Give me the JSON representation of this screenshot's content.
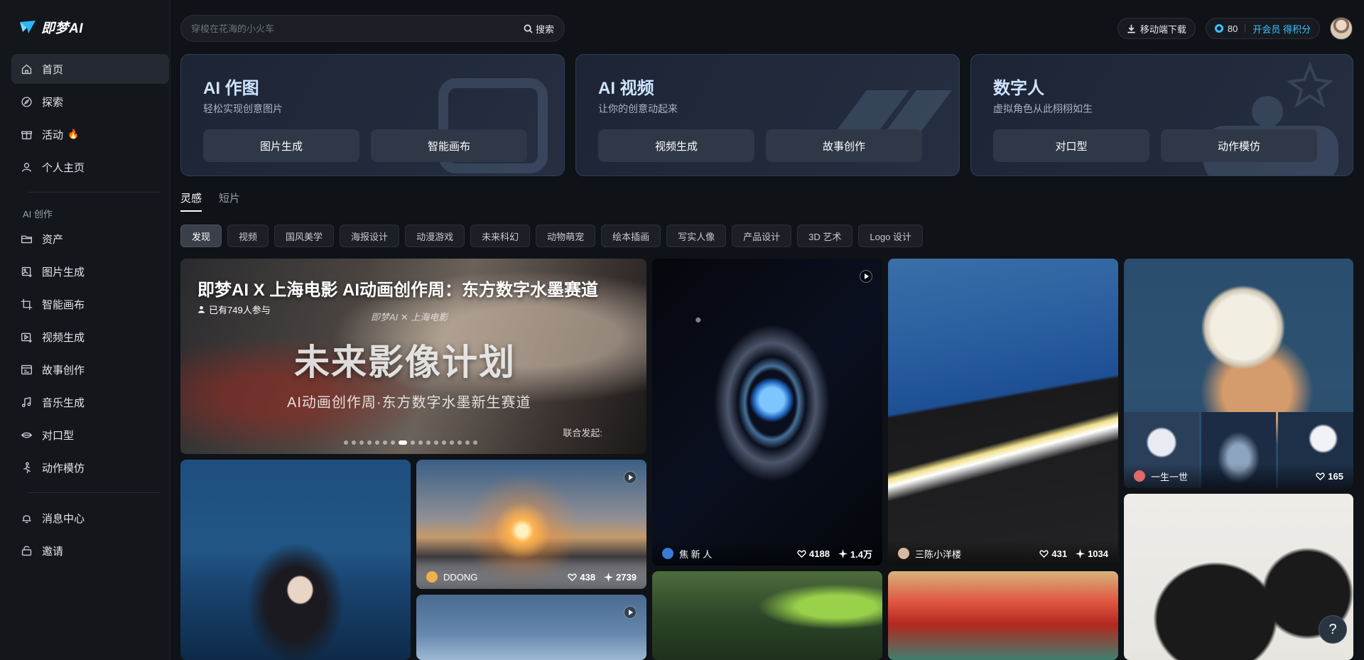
{
  "app": {
    "logo_text": "即梦AI"
  },
  "sidebar": {
    "items": [
      {
        "label": "首页",
        "icon": "home-icon",
        "active": true
      },
      {
        "label": "探索",
        "icon": "compass-icon"
      },
      {
        "label": "活动",
        "icon": "gift-icon",
        "badge": "fire-icon"
      },
      {
        "label": "个人主页",
        "icon": "user-icon"
      }
    ],
    "section_title": "AI 创作",
    "create_items": [
      {
        "label": "资产",
        "icon": "folder-icon"
      },
      {
        "label": "图片生成",
        "icon": "image-plus-icon"
      },
      {
        "label": "智能画布",
        "icon": "crop-icon"
      },
      {
        "label": "视频生成",
        "icon": "video-plus-icon"
      },
      {
        "label": "故事创作",
        "icon": "story-icon"
      },
      {
        "label": "音乐生成",
        "icon": "music-icon"
      },
      {
        "label": "对口型",
        "icon": "lips-icon"
      },
      {
        "label": "动作模仿",
        "icon": "motion-icon"
      }
    ],
    "bottom_items": [
      {
        "label": "消息中心",
        "icon": "bell-icon"
      },
      {
        "label": "邀请",
        "icon": "lock-icon"
      }
    ]
  },
  "search": {
    "placeholder": "穿梭在花海的小火车",
    "button_label": "搜索"
  },
  "header": {
    "download_label": "移动端下载",
    "credits": "80",
    "vip_label": "开会员 得积分"
  },
  "features": [
    {
      "title": "AI 作图",
      "subtitle": "轻松实现创意图片",
      "buttons": [
        "图片生成",
        "智能画布"
      ]
    },
    {
      "title": "AI 视频",
      "subtitle": "让你的创意动起来",
      "buttons": [
        "视频生成",
        "故事创作"
      ]
    },
    {
      "title": "数字人",
      "subtitle": "虚拟角色从此栩栩如生",
      "buttons": [
        "对口型",
        "动作模仿"
      ]
    }
  ],
  "tabs": [
    "灵感",
    "短片"
  ],
  "chips": [
    "发现",
    "视频",
    "国风美学",
    "海报设计",
    "动漫游戏",
    "未来科幻",
    "动物萌宠",
    "绘本插画",
    "写实人像",
    "产品设计",
    "3D 艺术",
    "Logo 设计"
  ],
  "banner": {
    "title": "即梦AI X 上海电影 AI动画创作周：东方数字水墨赛道",
    "participants": "已有749人参与",
    "logos": "即梦AI  ✕  上海电影",
    "big_text": "未来影像计划",
    "sub_text": "AI动画创作周·东方数字水墨新生赛道",
    "sponsor": "联合发起:",
    "active_dot": 7,
    "dot_count": 17
  },
  "cards": {
    "sunset": {
      "author": "DDONG",
      "likes": "438",
      "uses": "2739"
    },
    "galaxy": {
      "author": "焦 新 人",
      "likes": "4188",
      "uses": "1.4万"
    },
    "beach": {
      "author": "三陈小洋楼",
      "likes": "431",
      "uses": "1034"
    },
    "moon": {
      "author": "一生一世",
      "likes": "165"
    }
  },
  "colors": {
    "accent": "#38c3ff",
    "background": "#0f1216",
    "card_border": "#2d3f5a"
  },
  "help_label": "?"
}
